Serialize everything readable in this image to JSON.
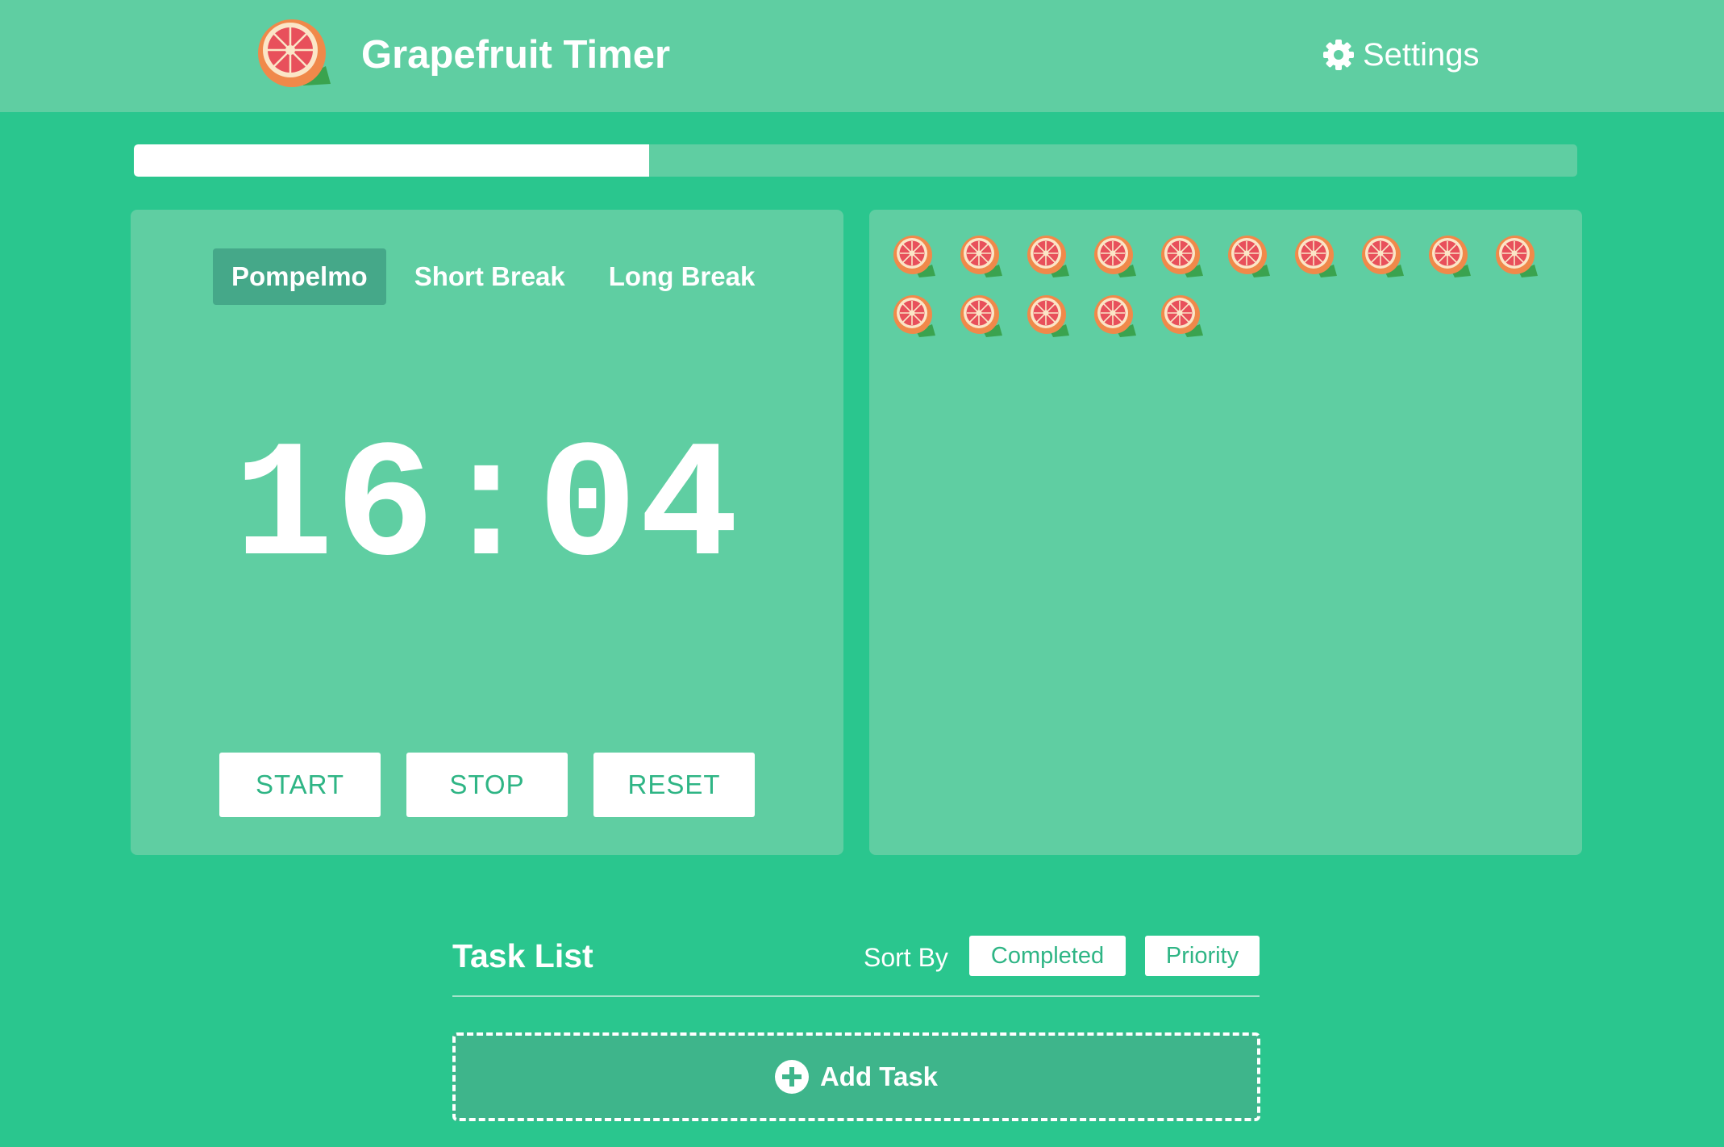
{
  "header": {
    "app_title": "Grapefruit Timer",
    "logo_icon": "grapefruit-logo",
    "settings_label": "Settings",
    "settings_icon": "gear-icon"
  },
  "progress": {
    "fraction": 0.357
  },
  "timer": {
    "tabs": [
      {
        "label": "Pompelmo",
        "active": true
      },
      {
        "label": "Short Break",
        "active": false
      },
      {
        "label": "Long Break",
        "active": false
      }
    ],
    "time": "16:04",
    "controls": {
      "start": "START",
      "stop": "STOP",
      "reset": "RESET"
    }
  },
  "completed_pomodoros": {
    "count": 15,
    "icon": "grapefruit-icon"
  },
  "task_list": {
    "title": "Task List",
    "sort_by_label": "Sort By",
    "sort_options": [
      "Completed",
      "Priority"
    ],
    "add_task_label": "Add Task",
    "add_icon": "plus-circle-icon"
  },
  "colors": {
    "background": "#2ac68e",
    "panel": "#5fcea2",
    "active_tab": "#45a889",
    "button_text": "#2fb585",
    "add_task_bg": "#3eb58b"
  }
}
